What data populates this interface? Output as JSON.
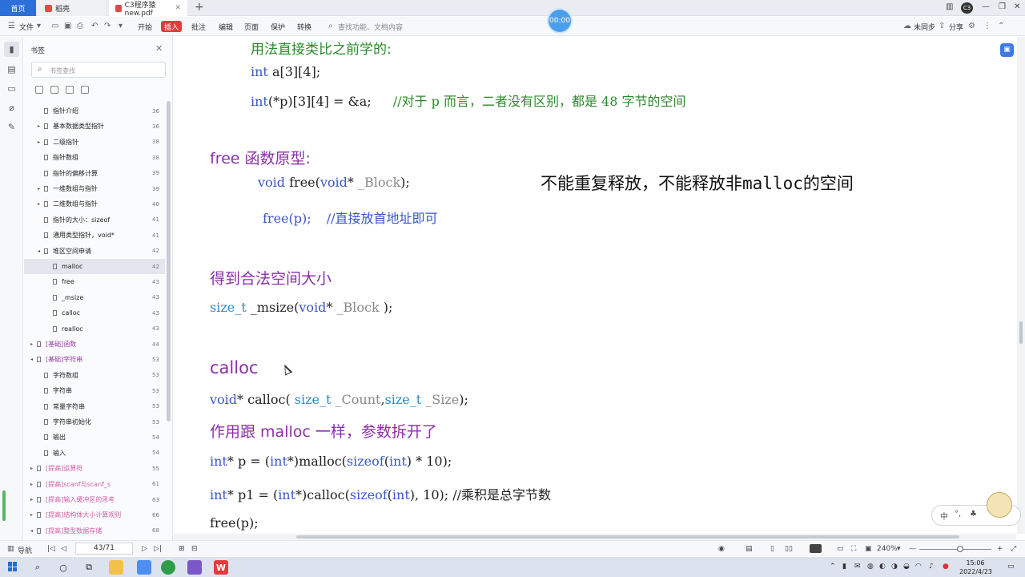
{
  "tabs": {
    "home": "首页",
    "tab1": "稻壳",
    "tab2": "C3程序猿new.pdf",
    "add": "+"
  },
  "timer": "00:00",
  "toolbar": {
    "file": "文件",
    "start": "开始",
    "insert": "插入",
    "comment": "批注",
    "edit": "编辑",
    "page": "页面",
    "protect": "保护",
    "convert": "转换",
    "search": "查找功能、文档内容",
    "sync": "未同步",
    "share": "分享"
  },
  "panel": {
    "title": "书签",
    "search_placeholder": "书签查找",
    "bookmarks": [
      {
        "label": "指针介绍",
        "page": "36",
        "arrow": "",
        "level": 1,
        "style": ""
      },
      {
        "label": "基本数据类型指针",
        "page": "36",
        "arrow": "▸",
        "level": 1,
        "style": ""
      },
      {
        "label": "二级指针",
        "page": "38",
        "arrow": "▸",
        "level": 1,
        "style": ""
      },
      {
        "label": "指针数组",
        "page": "38",
        "arrow": "",
        "level": 1,
        "style": ""
      },
      {
        "label": "指针的偏移计算",
        "page": "39",
        "arrow": "",
        "level": 1,
        "style": ""
      },
      {
        "label": "一维数组与指针",
        "page": "39",
        "arrow": "▸",
        "level": 1,
        "style": ""
      },
      {
        "label": "二维数组与指针",
        "page": "40",
        "arrow": "▸",
        "level": 1,
        "style": ""
      },
      {
        "label": "指针的大小：sizeof",
        "page": "41",
        "arrow": "",
        "level": 1,
        "style": ""
      },
      {
        "label": "通用类型指针，void*",
        "page": "41",
        "arrow": "",
        "level": 1,
        "style": ""
      },
      {
        "label": "堆区空间申请",
        "page": "42",
        "arrow": "◂",
        "level": 1,
        "style": ""
      },
      {
        "label": "malloc",
        "page": "42",
        "arrow": "",
        "level": 2,
        "style": "sel"
      },
      {
        "label": "free",
        "page": "43",
        "arrow": "",
        "level": 2,
        "style": ""
      },
      {
        "label": "_msize",
        "page": "43",
        "arrow": "",
        "level": 2,
        "style": ""
      },
      {
        "label": "calloc",
        "page": "43",
        "arrow": "",
        "level": 2,
        "style": ""
      },
      {
        "label": "realloc",
        "page": "43",
        "arrow": "",
        "level": 2,
        "style": ""
      },
      {
        "label": "[基础]函数",
        "page": "44",
        "arrow": "▸",
        "level": 0,
        "style": "purple"
      },
      {
        "label": "[基础]字符串",
        "page": "53",
        "arrow": "◂",
        "level": 0,
        "style": "purple"
      },
      {
        "label": "字符数组",
        "page": "53",
        "arrow": "",
        "level": 1,
        "style": ""
      },
      {
        "label": "字符串",
        "page": "53",
        "arrow": "",
        "level": 1,
        "style": ""
      },
      {
        "label": "常量字符串",
        "page": "53",
        "arrow": "",
        "level": 1,
        "style": ""
      },
      {
        "label": "字符串初始化",
        "page": "53",
        "arrow": "",
        "level": 1,
        "style": ""
      },
      {
        "label": "输出",
        "page": "54",
        "arrow": "",
        "level": 1,
        "style": ""
      },
      {
        "label": "输入",
        "page": "54",
        "arrow": "",
        "level": 1,
        "style": ""
      },
      {
        "label": "[提高]运算符",
        "page": "55",
        "arrow": "▸",
        "level": 0,
        "style": "pink"
      },
      {
        "label": "[提高]scanf与scanf_s",
        "page": "61",
        "arrow": "▸",
        "level": 0,
        "style": "pink"
      },
      {
        "label": "[提高]输入缓冲区的思考",
        "page": "63",
        "arrow": "▸",
        "level": 0,
        "style": "pink"
      },
      {
        "label": "[提高]结构体大小计算规则",
        "page": "66",
        "arrow": "▸",
        "level": 0,
        "style": "pink"
      },
      {
        "label": "[提高]整型数据存储",
        "page": "68",
        "arrow": "◂",
        "level": 0,
        "style": "pink"
      }
    ]
  },
  "doc": {
    "l1": "用法直接类比之前学的:",
    "l2_kw": "int",
    "l2_rest": " a[3][4];",
    "l3_kw": "int",
    "l3_rest": "(*p)[3][4] = &a;",
    "l3_comment": "//对于 p 而言，二者没有区别，都是 48 字节的空间",
    "h_free": "free 函数原型:",
    "free_sig_void": "void",
    "free_sig_mid": " free(",
    "free_sig_void2": "void",
    "free_sig_star": "* ",
    "free_sig_param": "_Block",
    "free_sig_end": ");",
    "note": "不能重复释放，不能释放非malloc的空间",
    "free_call": "free(p);",
    "free_comment": "//直接放首地址即可",
    "h_msize": "得到合法空间大小",
    "msize_type": "size_t",
    "msize_mid": " _msize(",
    "msize_void": "void",
    "msize_star": "* ",
    "msize_param": "_Block",
    "msize_end": " );",
    "h_calloc": "calloc",
    "calloc_void": "void",
    "calloc_mid": "* calloc( ",
    "calloc_t1": "size_t",
    "calloc_p1": " _Count",
    "calloc_comma": ",",
    "calloc_t2": "size_t",
    "calloc_p2": " _Size",
    "calloc_end": ");",
    "h_same": "作用跟 malloc 一样，参数拆开了",
    "m1_a": "int",
    "m1_b": "* p = (",
    "m1_c": "int",
    "m1_d": "*)malloc(",
    "m1_e": "sizeof",
    "m1_f": "(",
    "m1_g": "int",
    "m1_h": ") * 10);",
    "m2_a": "int",
    "m2_b": "* p1 = (",
    "m2_c": "int",
    "m2_d": "*)calloc(",
    "m2_e": "sizeof",
    "m2_f": "(",
    "m2_g": "int",
    "m2_h": "), 10);",
    "m2_comment": " //乘积是总字节数",
    "m3": "free(p);"
  },
  "status": {
    "nav": "导航",
    "page": "43/71",
    "zoom": "240%"
  },
  "taskbar": {
    "time": "15:06",
    "date": "2022/4/23"
  },
  "ime": {
    "lang": "中",
    "dot": "°,"
  },
  "colors": {
    "accent": "#2b6fd9",
    "heading": "#8b2fa8",
    "keyword": "#3a56c9",
    "comment": "#2b8a2b"
  }
}
